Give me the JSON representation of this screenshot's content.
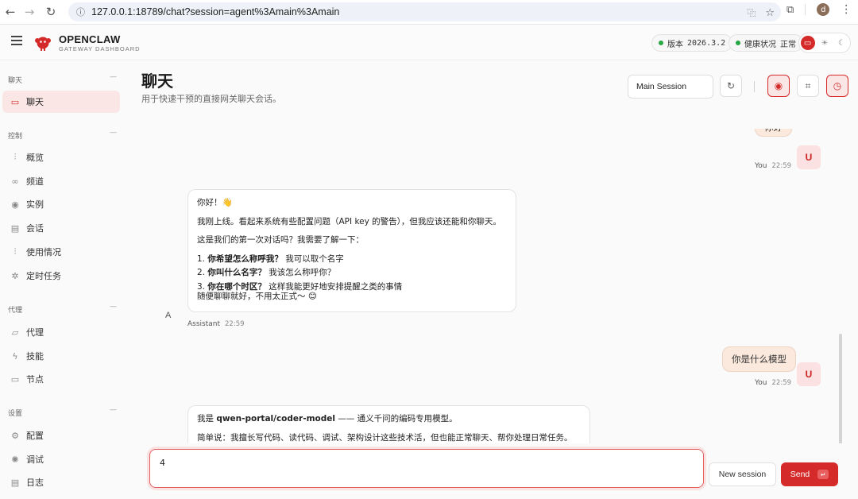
{
  "browser": {
    "url": "127.0.0.1:18789/chat?session=agent%3Amain%3Amain",
    "profile_initial": "d"
  },
  "header": {
    "brand": "OPENCLAW",
    "brand_sub": "GATEWAY DASHBOARD",
    "version_label": "版本",
    "version_value": "2026.3.2",
    "health_label": "健康状况",
    "health_value": "正常",
    "status_color": "#28a745",
    "accent_color": "#d42a2a"
  },
  "sidebar": {
    "sections": [
      {
        "title": "聊天",
        "items": [
          {
            "label": "聊天",
            "icon": "chat-icon",
            "active": true
          }
        ]
      },
      {
        "title": "控制",
        "items": [
          {
            "label": "概览",
            "icon": "bar-chart-icon"
          },
          {
            "label": "频道",
            "icon": "link-icon"
          },
          {
            "label": "实例",
            "icon": "broadcast-icon"
          },
          {
            "label": "会话",
            "icon": "document-icon"
          },
          {
            "label": "使用情况",
            "icon": "bar-chart-icon"
          },
          {
            "label": "定时任务",
            "icon": "spark-icon"
          }
        ]
      },
      {
        "title": "代理",
        "items": [
          {
            "label": "代理",
            "icon": "folder-icon"
          },
          {
            "label": "技能",
            "icon": "bolt-icon"
          },
          {
            "label": "节点",
            "icon": "monitor-icon"
          }
        ]
      },
      {
        "title": "设置",
        "items": [
          {
            "label": "配置",
            "icon": "gear-icon"
          },
          {
            "label": "调试",
            "icon": "bug-icon"
          },
          {
            "label": "日志",
            "icon": "log-icon"
          }
        ]
      }
    ]
  },
  "main": {
    "title": "聊天",
    "subtitle": "用于快速干预的直接网关聊天会话。",
    "session_select": "Main Session"
  },
  "chat": {
    "messages": [
      {
        "role": "user",
        "text": "你好",
        "sender": "You",
        "time": "22:59",
        "avatar": "U"
      },
      {
        "role": "assistant",
        "sender": "Assistant",
        "time": "22:59",
        "avatar": "A",
        "lines": [
          "你好！👋",
          "我刚上线。看起来系统有些配置问题（API key 的警告），但我应该还能和你聊天。",
          "这是我们的第一次对话吗？我需要了解一下："
        ],
        "list": [
          {
            "num": "1.",
            "bold": "你希望怎么称呼我？",
            "rest": " 我可以取个名字"
          },
          {
            "num": "2.",
            "bold": "你叫什么名字？",
            "rest": " 我该怎么称呼你？"
          },
          {
            "num": "3.",
            "bold": "你在哪个时区？",
            "rest": " 这样我能更好地安排提醒之类的事情"
          }
        ],
        "closing": "随便聊聊就好，不用太正式～ 😊"
      },
      {
        "role": "user",
        "text": "你是什么模型",
        "sender": "You",
        "time": "22:59",
        "avatar": "U"
      },
      {
        "role": "assistant",
        "line1_pre": "我是 ",
        "line1_bold": "qwen-portal/coder-model",
        "line1_post": " —— 通义千问的编码专用模型。",
        "line2": "简单说：我擅长写代码、读代码、调试、架构设计这些技术活，但也能正常聊天、帮你处理日常任务。"
      }
    ]
  },
  "composer": {
    "value": "4",
    "new_session_label": "New session",
    "send_label": "Send",
    "send_key": "↵"
  }
}
